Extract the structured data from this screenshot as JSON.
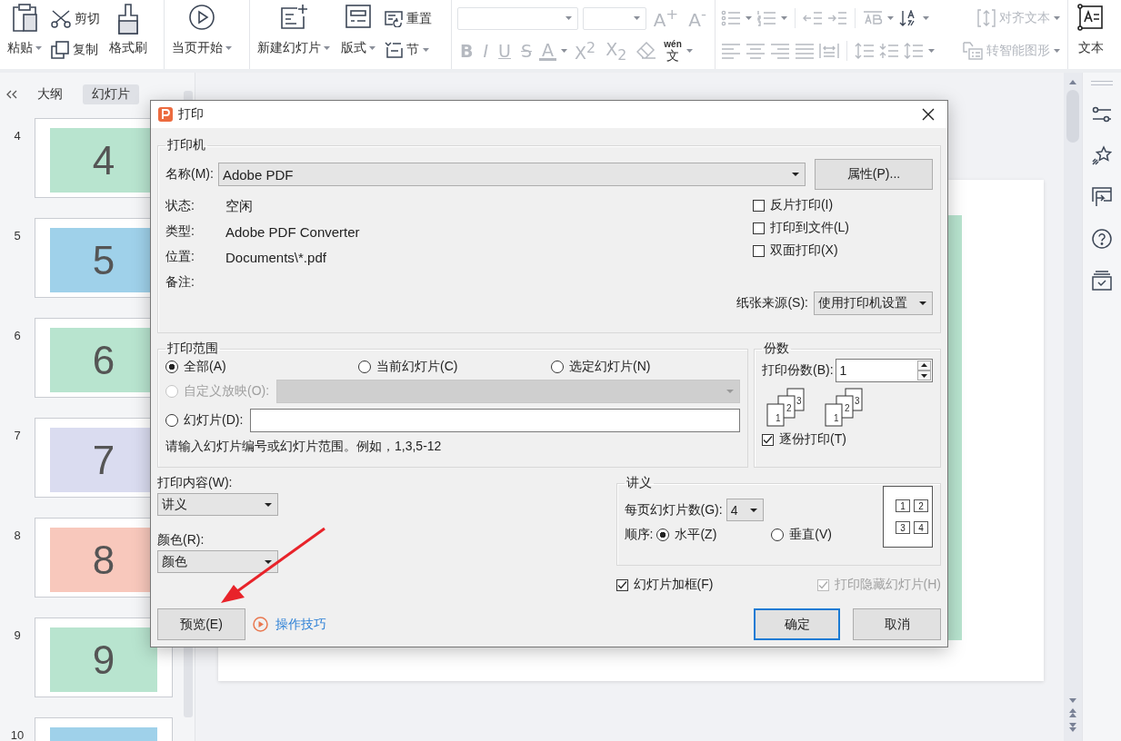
{
  "ribbon": {
    "paste": {
      "label": "粘贴",
      "dropdown": true
    },
    "cut": {
      "label": "剪切"
    },
    "copy": {
      "label": "复制"
    },
    "format_painter": {
      "label": "格式刷"
    },
    "play_from_current": {
      "label": "当页开始",
      "dropdown": true
    },
    "new_slide": {
      "label": "新建幻灯片",
      "dropdown": true
    },
    "layout": {
      "label": "版式",
      "dropdown": true
    },
    "reset": {
      "label": "重置"
    },
    "section": {
      "label": "节",
      "dropdown": true
    },
    "align_text": {
      "label": "对齐文本",
      "dropdown": true,
      "disabled": true
    },
    "smartart": {
      "label": "转智能图形",
      "dropdown": true,
      "disabled": true
    },
    "text_box": {
      "label": "文本"
    }
  },
  "text_formatting": {
    "disabled": true,
    "font_size_tools": [
      {
        "label": "A$^{+}$"
      },
      {
        "label": "A$^{-}$"
      }
    ],
    "font_style_tools": [
      {
        "kind": "bold",
        "label": "B"
      },
      {
        "kind": "italic",
        "label": "I"
      },
      {
        "kind": "underline",
        "label": "U"
      },
      {
        "kind": "strike",
        "label": "S"
      },
      {
        "kind": "font-color",
        "label": "A",
        "dropdown": true
      },
      {
        "kind": "superscript",
        "label": "X$^{2}$"
      },
      {
        "kind": "subscript",
        "label": "X$_{2}$"
      },
      {
        "kind": "eraser"
      },
      {
        "kind": "phonetic",
        "ruby": "wén",
        "label": "文",
        "dropdown": true
      }
    ]
  },
  "outline_panel": {
    "tabs": [
      {
        "label": "大纲",
        "selected": false
      },
      {
        "label": "幻灯片",
        "selected": true
      }
    ],
    "slides": [
      {
        "number": "4",
        "thumbnail_text": "4",
        "color": "#b8e4cf"
      },
      {
        "number": "5",
        "thumbnail_text": "5",
        "color": "#9fd1ea"
      },
      {
        "number": "6",
        "thumbnail_text": "6",
        "color": "#b8e4cf"
      },
      {
        "number": "7",
        "thumbnail_text": "7",
        "color": "#dadcf0"
      },
      {
        "number": "8",
        "thumbnail_text": "8",
        "color": "#f8c8bc"
      },
      {
        "number": "9",
        "thumbnail_text": "9",
        "color": "#b8e4cf"
      },
      {
        "number": "10",
        "color": "#9fd1ea"
      }
    ]
  },
  "print_dialog": {
    "title": "打印",
    "printer": {
      "legend": "打印机",
      "name_label": "名称(M):",
      "name_value": "Adobe PDF",
      "properties_button": "属性(P)...",
      "info": [
        {
          "label": "状态:",
          "value": "空闲"
        },
        {
          "label": "类型:",
          "value": "Adobe PDF Converter"
        },
        {
          "label": "位置:",
          "value": "Documents\\*.pdf"
        },
        {
          "label": "备注:"
        }
      ],
      "options": [
        {
          "label": "反片打印(I)",
          "checked": false
        },
        {
          "label": "打印到文件(L)",
          "checked": false
        },
        {
          "label": "双面打印(X)",
          "checked": false
        }
      ],
      "paper_source_label": "纸张来源(S):",
      "paper_source_value": "使用打印机设置"
    },
    "range": {
      "legend": "打印范围",
      "choices": [
        {
          "label": "全部(A)",
          "selected": true
        },
        {
          "label": "当前幻灯片(C)",
          "selected": false
        },
        {
          "label": "选定幻灯片(N)",
          "selected": false
        }
      ],
      "custom_show": {
        "label": "自定义放映(O):",
        "selected": false,
        "disabled": true
      },
      "slides": {
        "label": "幻灯片(D):",
        "selected": false
      },
      "hint": "请输入幻灯片编号或幻灯片范围。例如，1,3,5-12"
    },
    "copies": {
      "legend": "份数",
      "count_label": "打印份数(B):",
      "count_value": "1",
      "page_stacks": [
        {
          "pages": [
            "1",
            "2",
            "3"
          ]
        },
        {
          "pages": [
            "1",
            "2",
            "3"
          ]
        }
      ],
      "collate": {
        "label": "逐份打印(T)",
        "checked": true
      }
    },
    "content": {
      "label": "打印内容(W):",
      "value": "讲义"
    },
    "color": {
      "label": "颜色(R):",
      "value": "颜色"
    },
    "handouts": {
      "legend": "讲义",
      "per_page_label": "每页幻灯片数(G):",
      "per_page_value": "4",
      "order_label": "顺序:",
      "orders": [
        {
          "label": "水平(Z)",
          "selected": true
        },
        {
          "label": "垂直(V)",
          "selected": false
        }
      ],
      "preview_numbers": [
        "1",
        "2",
        "3",
        "4"
      ]
    },
    "frame_slides": {
      "label": "幻灯片加框(F)",
      "checked": true
    },
    "print_hidden": {
      "label": "打印隐藏幻灯片(H)",
      "checked": true,
      "disabled": true
    },
    "preview_button": "预览(E)",
    "tips_link": "操作技巧",
    "ok_button": "确定",
    "cancel_button": "取消"
  }
}
